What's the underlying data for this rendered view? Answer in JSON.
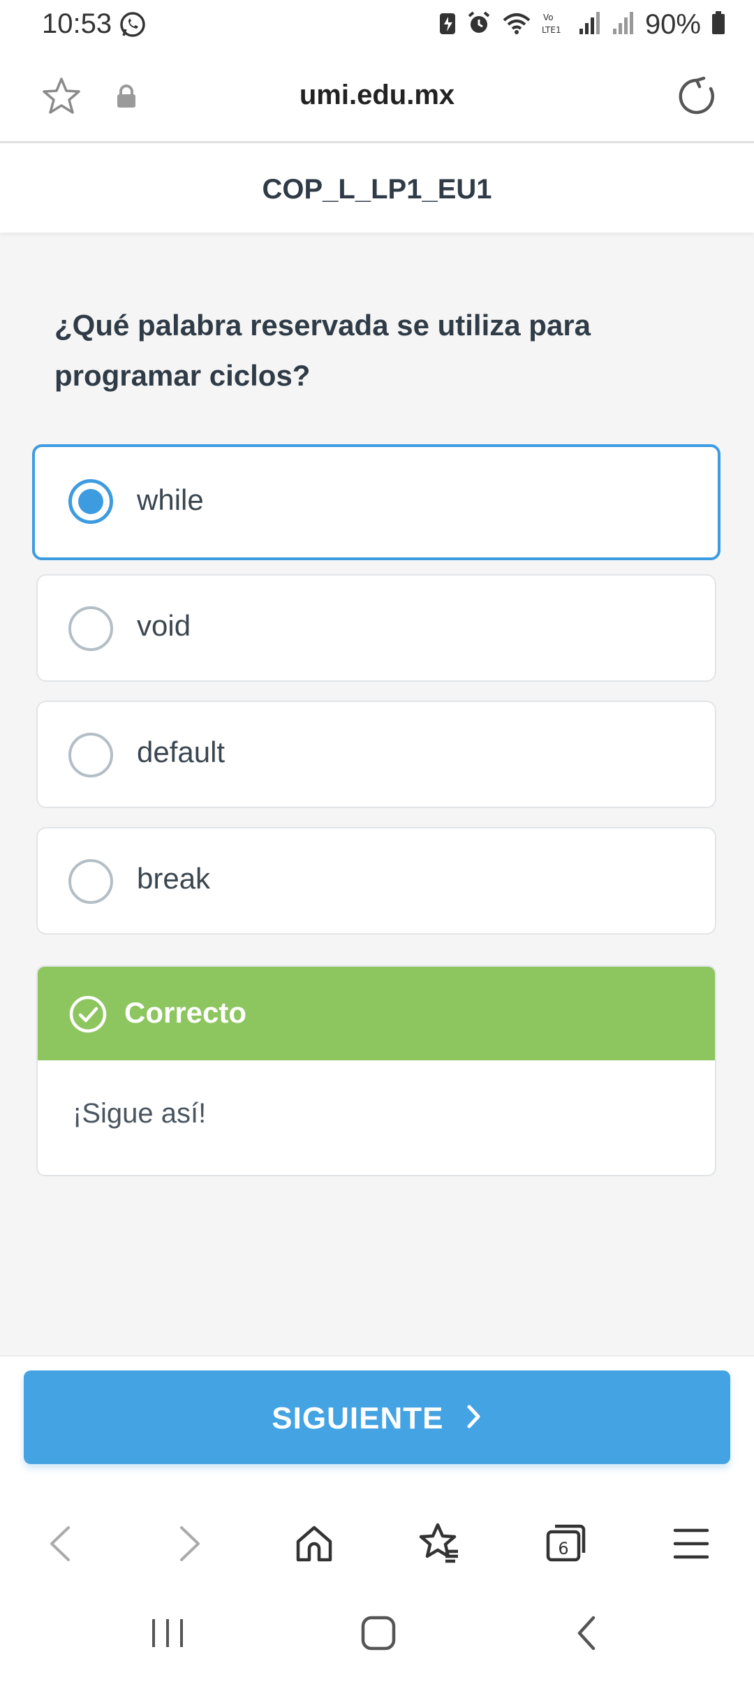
{
  "status_bar": {
    "time": "10:53",
    "battery": "90%",
    "icons": [
      "whatsapp-icon",
      "battery-saver-icon",
      "alarm-icon",
      "wifi-icon",
      "volte-icon",
      "signal-icon",
      "battery-icon"
    ]
  },
  "browser": {
    "url": "umi.edu.mx",
    "icons": [
      "bookmark-star-icon",
      "lock-icon",
      "reload-icon"
    ]
  },
  "page": {
    "title": "COP_L_LP1_EU1",
    "question": "¿Qué palabra reservada se utiliza para programar ciclos?",
    "options": [
      {
        "label": "while",
        "selected": true
      },
      {
        "label": "void",
        "selected": false
      },
      {
        "label": "default",
        "selected": false
      },
      {
        "label": "break",
        "selected": false
      }
    ],
    "feedback": {
      "title": "Correcto",
      "message": "¡Sigue así!",
      "color": "#8dc55f"
    },
    "next_button": "SIGUIENTE",
    "accent_color": "#43a3e3"
  },
  "browser_nav": {
    "tab_count": "6",
    "icons": [
      "back-icon",
      "forward-icon",
      "home-icon",
      "bookmarks-icon",
      "tabs-icon",
      "menu-icon"
    ]
  },
  "system_nav": {
    "icons": [
      "recents-icon",
      "home-button-icon",
      "back-button-icon"
    ]
  }
}
